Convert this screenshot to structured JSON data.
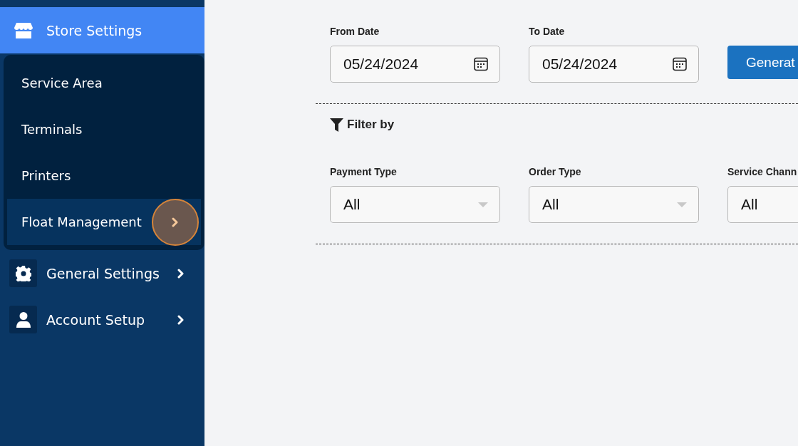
{
  "sidebar": {
    "items": [
      {
        "label": "Store Settings",
        "selected": true,
        "expanded": true,
        "children": [
          {
            "label": "Service Area",
            "selected": false
          },
          {
            "label": "Terminals",
            "selected": false
          },
          {
            "label": "Printers",
            "selected": false
          },
          {
            "label": "Float Management",
            "selected": true
          }
        ]
      },
      {
        "label": "General Settings",
        "selected": false,
        "expanded": false
      },
      {
        "label": "Account Setup",
        "selected": false,
        "expanded": false
      }
    ]
  },
  "date_range": {
    "fields": [
      {
        "label": "From Date",
        "value": "05/24/2024"
      },
      {
        "label": "To Date",
        "value": "05/24/2024"
      }
    ],
    "button": "Generat"
  },
  "filter": {
    "title": "Filter by",
    "selects": [
      {
        "label": "Payment Type",
        "value": "All"
      },
      {
        "label": "Order Type",
        "value": "All"
      },
      {
        "label": "Service Chann",
        "value": "All"
      }
    ]
  }
}
